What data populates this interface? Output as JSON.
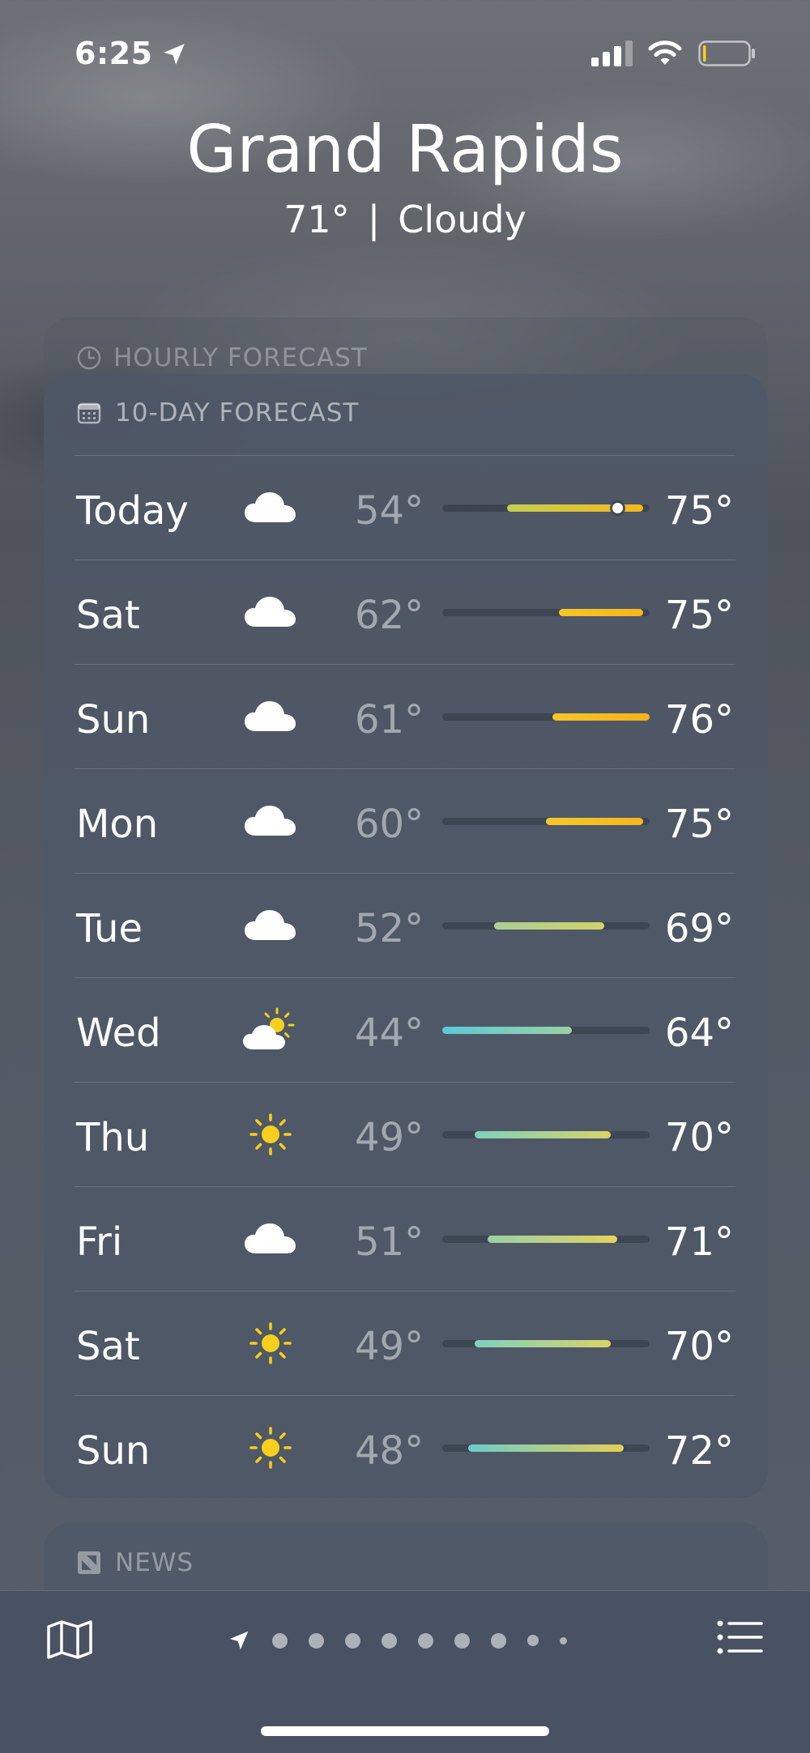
{
  "status_bar": {
    "time": "6:25"
  },
  "header": {
    "city": "Grand Rapids",
    "temperature": "71°",
    "separator": "|",
    "condition": "Cloudy"
  },
  "hourly": {
    "title": "HOURLY FORECAST"
  },
  "forecast": {
    "title": "10-DAY FORECAST",
    "scale_min": 44,
    "scale_max": 76,
    "days": [
      {
        "day": "Today",
        "icon": "cloud-icon",
        "low": "54°",
        "high": "75°",
        "low_val": 54,
        "high_val": 75,
        "current_val": 71,
        "color_from": "#c4cf55",
        "color_to": "#f5b71e"
      },
      {
        "day": "Sat",
        "icon": "cloud-icon",
        "low": "62°",
        "high": "75°",
        "low_val": 62,
        "high_val": 75,
        "color_from": "#f6c529",
        "color_to": "#f5b71e"
      },
      {
        "day": "Sun",
        "icon": "cloud-icon",
        "low": "61°",
        "high": "76°",
        "low_val": 61,
        "high_val": 76,
        "color_from": "#f6c529",
        "color_to": "#f4b21a"
      },
      {
        "day": "Mon",
        "icon": "cloud-icon",
        "low": "60°",
        "high": "75°",
        "low_val": 60,
        "high_val": 75,
        "color_from": "#f5c72c",
        "color_to": "#f5b71e"
      },
      {
        "day": "Tue",
        "icon": "cloud-icon",
        "low": "52°",
        "high": "69°",
        "low_val": 52,
        "high_val": 69,
        "color_from": "#a9cf94",
        "color_to": "#d2d367"
      },
      {
        "day": "Wed",
        "icon": "partly-sunny-icon",
        "low": "44°",
        "high": "64°",
        "low_val": 44,
        "high_val": 64,
        "color_from": "#5cc9d6",
        "color_to": "#99d0a3"
      },
      {
        "day": "Thu",
        "icon": "sun-icon",
        "low": "49°",
        "high": "70°",
        "low_val": 49,
        "high_val": 70,
        "color_from": "#7fd0be",
        "color_to": "#d8d467"
      },
      {
        "day": "Fri",
        "icon": "cloud-icon",
        "low": "51°",
        "high": "71°",
        "low_val": 51,
        "high_val": 71,
        "color_from": "#99d0a6",
        "color_to": "#e3d35e"
      },
      {
        "day": "Sat",
        "icon": "sun-icon",
        "low": "49°",
        "high": "70°",
        "low_val": 49,
        "high_val": 70,
        "color_from": "#7fd0be",
        "color_to": "#d8d467"
      },
      {
        "day": "Sun",
        "icon": "sun-icon",
        "low": "48°",
        "high": "72°",
        "low_val": 48,
        "high_val": 72,
        "color_from": "#6ccdc8",
        "color_to": "#e6cf55"
      }
    ]
  },
  "news": {
    "title": "NEWS"
  },
  "colors": {
    "sun": "#f7cf1c",
    "card": "#4e5867"
  },
  "pager": {
    "page_count": 9,
    "active_index": 0
  }
}
